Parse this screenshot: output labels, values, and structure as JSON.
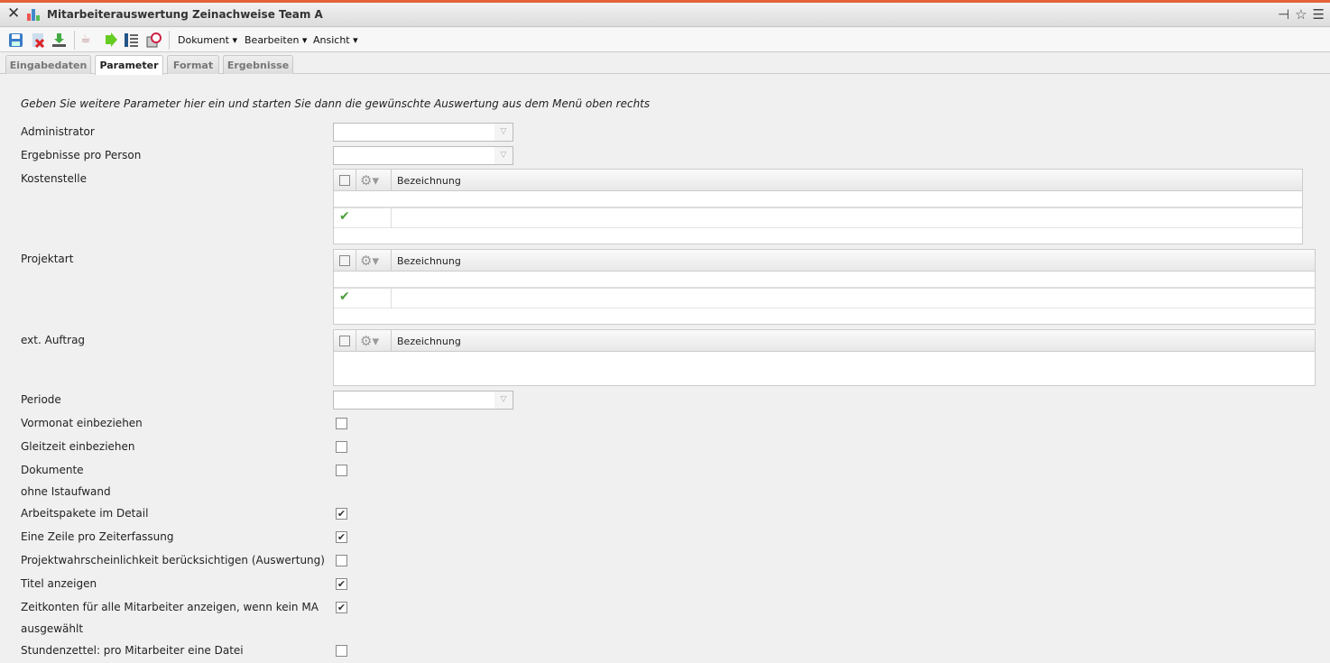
{
  "window": {
    "title": "Mitarbeiterauswertung Zeinachweise Team A"
  },
  "toolbar": {
    "menus": [
      "Dokument ▾",
      "Bearbeiten ▾",
      "Ansicht ▾"
    ]
  },
  "tabs": [
    "Eingabedaten",
    "Parameter",
    "Format",
    "Ergebnisse"
  ],
  "active_tab": "Parameter",
  "instruction": "Geben Sie weitere Parameter hier ein und starten Sie dann die gewünschte Auswertung aus dem Menü oben rechts",
  "fields": {
    "administrator": "Administrator",
    "ergebnisse": "Ergebnisse pro Person",
    "kostenstelle": "Kostenstelle",
    "projektart": "Projektart",
    "ext_auftrag": "ext. Auftrag",
    "periode": "Periode"
  },
  "grid_header": "Bezeichnung",
  "checkboxes": [
    {
      "label": "Vormonat einbeziehen",
      "checked": false
    },
    {
      "label": "Gleitzeit einbeziehen",
      "checked": false
    },
    {
      "label": "Dokumente",
      "label2": "ohne Istaufwand",
      "checked": false
    },
    {
      "label": "Arbeitspakete im Detail",
      "checked": true
    },
    {
      "label": "Eine Zeile pro Zeiterfassung",
      "checked": true
    },
    {
      "label": "Projektwahrscheinlichkeit berücksichtigen (Auswertung)",
      "checked": false
    },
    {
      "label": "Titel anzeigen",
      "checked": true
    },
    {
      "label": "Zeitkonten für alle Mitarbeiter anzeigen, wenn kein MA",
      "label2": "ausgewählt",
      "checked": true
    },
    {
      "label": "Stundenzettel: pro Mitarbeiter eine Datei",
      "checked": false
    }
  ]
}
